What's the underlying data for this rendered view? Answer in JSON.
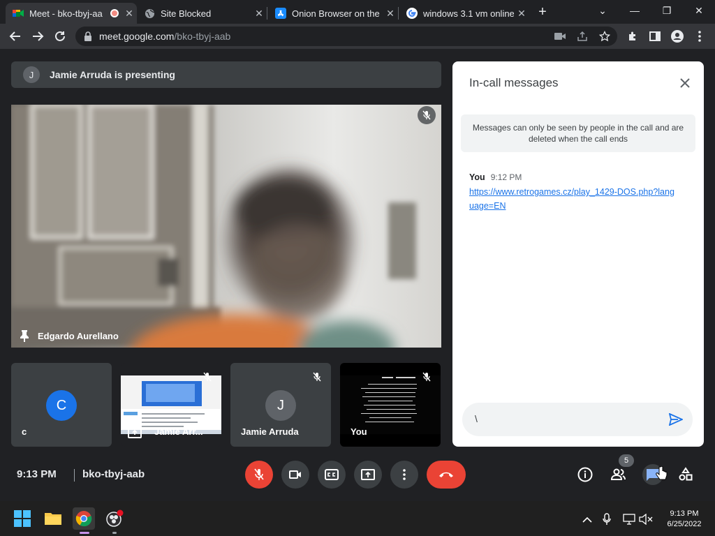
{
  "browser": {
    "tabs": [
      {
        "title": "Meet - bko-tbyj-aa",
        "active": true
      },
      {
        "title": "Site Blocked",
        "active": false
      },
      {
        "title": "Onion Browser on the",
        "active": false
      },
      {
        "title": "windows 3.1 vm online",
        "active": false
      }
    ],
    "url_host": "meet.google.com",
    "url_path": "/bko-tbyj-aab",
    "window_buttons": {
      "minimize": "—",
      "maximize": "❐",
      "close": "✕",
      "dropdown": "⌄"
    }
  },
  "meet": {
    "presenting_initial": "J",
    "presenting_text": "Jamie Arruda is presenting",
    "main_speaker": "Edgardo Aurellano",
    "tiles": [
      {
        "name": "c",
        "initial": "C",
        "avatar_color": "#1a73e8"
      },
      {
        "name": "Jamie Arr..."
      },
      {
        "name": "Jamie Arruda",
        "initial": "J",
        "avatar_color": "#5f6368"
      },
      {
        "name": "You"
      }
    ],
    "clock": "9:13 PM",
    "meeting_code": "bko-tbyj-aab",
    "participant_count": "5"
  },
  "chat": {
    "title": "In-call messages",
    "notice": "Messages can only be seen by people in the call and are deleted when the call ends",
    "messages": [
      {
        "sender": "You",
        "time": "9:12 PM",
        "text": "https://www.retrogames.cz/play_1429-DOS.php?language=EN"
      }
    ],
    "compose_value": "\\"
  },
  "taskbar": {
    "time": "9:13 PM",
    "date": "6/25/2022"
  },
  "colors": {
    "meet_red": "#ea4335",
    "link_blue": "#1a73e8",
    "surface_dark": "#202124",
    "tile_gray": "#3c4043"
  }
}
